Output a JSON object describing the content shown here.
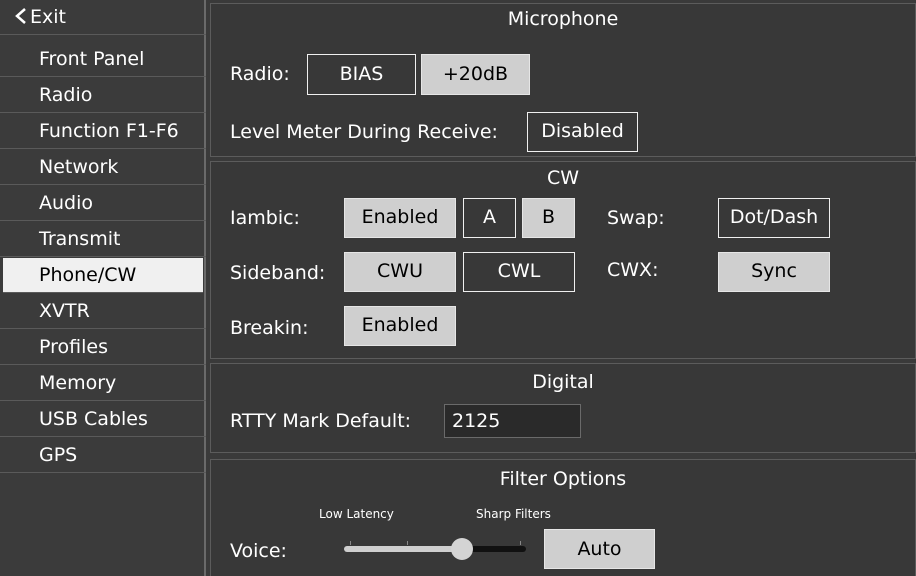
{
  "sidebar": {
    "exit_label": "Exit",
    "items": [
      {
        "label": "Front Panel"
      },
      {
        "label": "Radio"
      },
      {
        "label": "Function F1-F6"
      },
      {
        "label": "Network"
      },
      {
        "label": "Audio"
      },
      {
        "label": "Transmit"
      },
      {
        "label": "Phone/CW"
      },
      {
        "label": "XVTR"
      },
      {
        "label": "Profiles"
      },
      {
        "label": "Memory"
      },
      {
        "label": "USB Cables"
      },
      {
        "label": "GPS"
      }
    ],
    "selected": "Phone/CW"
  },
  "microphone": {
    "title": "Microphone",
    "radio_label": "Radio:",
    "bias_label": "BIAS",
    "boost_label": "+20dB",
    "level_meter_label": "Level Meter During Receive:",
    "level_meter_value": "Disabled"
  },
  "cw": {
    "title": "CW",
    "iambic_label": "Iambic:",
    "iambic_value": "Enabled",
    "mode_a": "A",
    "mode_b": "B",
    "swap_label": "Swap:",
    "swap_value": "Dot/Dash",
    "sideband_label": "Sideband:",
    "cwu_label": "CWU",
    "cwl_label": "CWL",
    "cwx_label": "CWX:",
    "cwx_value": "Sync",
    "breakin_label": "Breakin:",
    "breakin_value": "Enabled"
  },
  "digital": {
    "title": "Digital",
    "rtty_label": "RTTY Mark Default:",
    "rtty_value": "2125"
  },
  "filter": {
    "title": "Filter Options",
    "low_latency_label": "Low Latency",
    "sharp_filters_label": "Sharp Filters",
    "voice_label": "Voice:",
    "voice_slider_value": 0.65,
    "auto_label": "Auto"
  },
  "colors": {
    "background": "#3a3a3a",
    "button_on": "#cfcfcf",
    "selected_item": "#f0f0f0"
  }
}
